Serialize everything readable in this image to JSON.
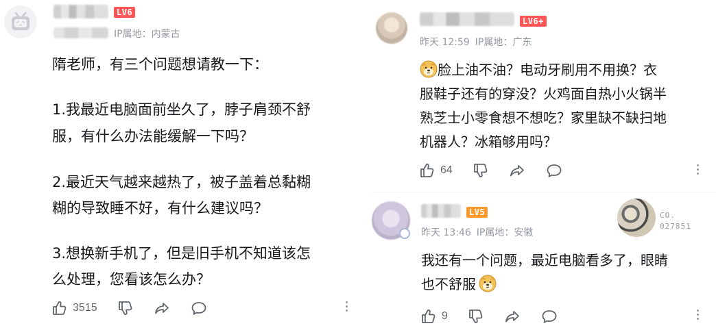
{
  "left_comment": {
    "level_badge": "LV6",
    "ip_location": "IP属地：内蒙古",
    "text_lines": [
      "隋老师，有三个问题想请教一下：",
      "1.我最近电脑面前坐久了，脖子肩颈不舒",
      "服，有什么办法能缓解一下吗？",
      "2.最近天气越来越热了，被子盖着总黏糊",
      "糊的导致睡不好，有什么建议吗？",
      "3.想换新手机了，但是旧手机不知道该怎",
      "么处理，您看该怎么办？"
    ],
    "like_count": "3515"
  },
  "right_comment_1": {
    "level_badge": "LV6+",
    "time": "昨天 12:59",
    "ip_location": "IP属地：广东",
    "text_lines": [
      "脸上油不油？电动牙刷用不用换？衣",
      "服鞋子还有的穿没？火鸡面自热小火锅半",
      "熟芝士小零食想不想吃？家里缺不缺扫地",
      "机器人？冰箱够用吗？"
    ],
    "like_count": "64"
  },
  "right_comment_2": {
    "level_badge": "LV5",
    "time": "昨天 13:46",
    "ip_location": "IP属地：安徽",
    "text_lines": [
      "我还有一个问题，最近电脑看多了，眼睛",
      "也不舒服"
    ],
    "like_count": "9",
    "badge_code": "CO.",
    "badge_number": "027851"
  },
  "icons": [
    "like-icon",
    "dislike-icon",
    "share-icon",
    "reply-icon",
    "more-icon",
    "doge-emoji"
  ],
  "colors": {
    "lv6": "#ff5757",
    "lv5": "#ff9a2e",
    "meta_text": "#9499a0",
    "main_text": "#18191c"
  }
}
